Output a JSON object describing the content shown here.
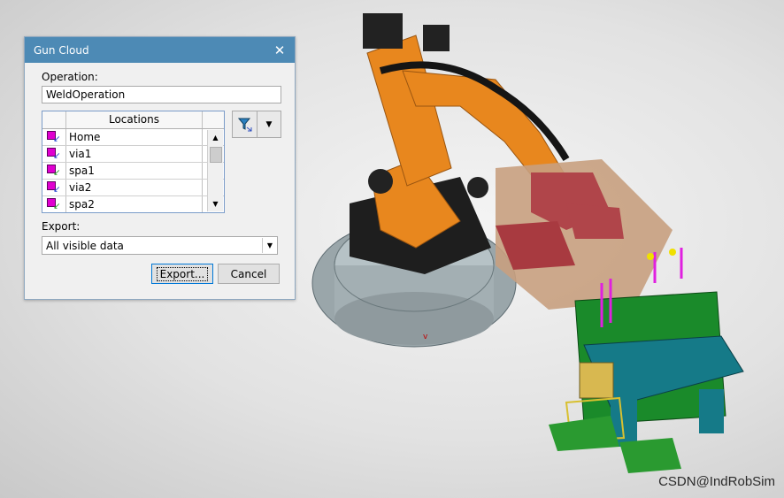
{
  "dialog": {
    "title": "Gun Cloud",
    "close_glyph": "✕",
    "operation_label": "Operation:",
    "operation_value": "WeldOperation",
    "locations_header": "Locations",
    "locations": [
      {
        "name": "Home",
        "checked": true,
        "icon": "via-location-icon"
      },
      {
        "name": "via1",
        "checked": true,
        "icon": "via-location-icon"
      },
      {
        "name": "spa1",
        "checked": true,
        "icon": "weld-point-icon"
      },
      {
        "name": "via2",
        "checked": true,
        "icon": "via-location-icon"
      },
      {
        "name": "spa2",
        "checked": true,
        "icon": "weld-point-icon"
      }
    ],
    "filter_icon": "filter-icon",
    "export_label": "Export:",
    "export_value": "All visible data",
    "export_button": "Export...",
    "cancel_button": "Cancel"
  },
  "viewport": {
    "description_icon": "robot-cell-3d-view",
    "watermark": "CSDN@IndRobSim"
  },
  "colors": {
    "titlebar": "#4d8ab5",
    "robot": "#e8871e",
    "fixture": "#1a8a2a",
    "base": "#a8b4b8"
  }
}
